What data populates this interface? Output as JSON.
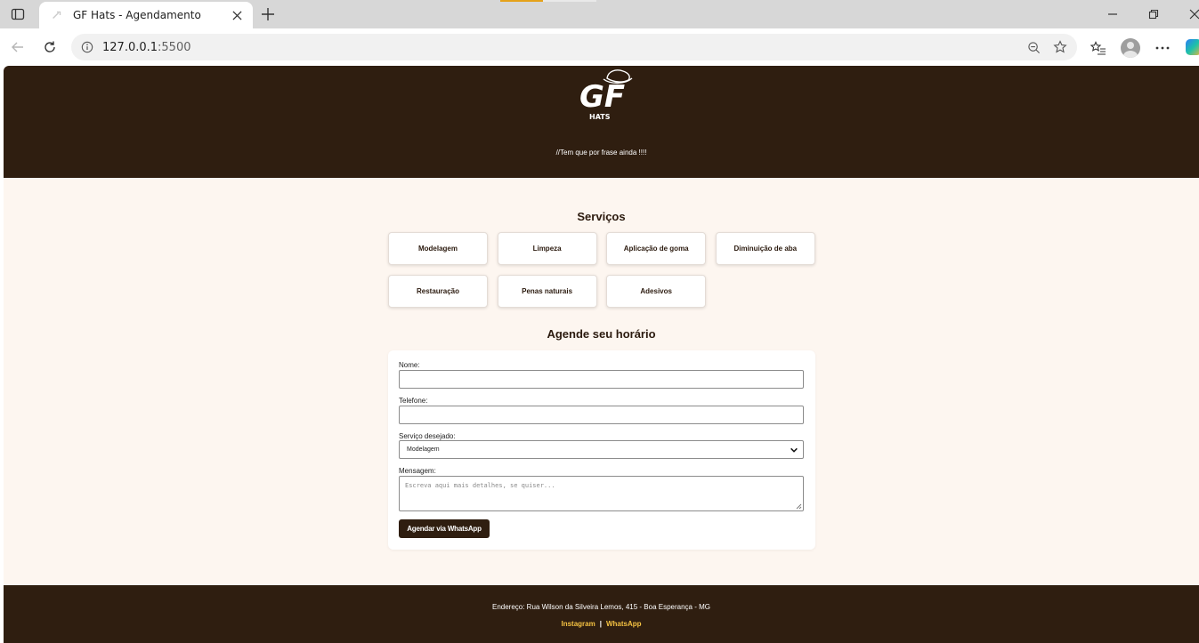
{
  "browser": {
    "tab_title": "GF Hats - Agendamento",
    "url_host": "127.0.0.1",
    "url_port": ":5500"
  },
  "header": {
    "logo_text": "GF",
    "logo_subtext": "HATS",
    "tagline": "//Tem que por frase ainda !!!!"
  },
  "services": {
    "title": "Serviços",
    "items": [
      "Modelagem",
      "Limpeza",
      "Aplicação de goma",
      "Diminuição de aba",
      "Restauração",
      "Penas naturais",
      "Adesivos"
    ]
  },
  "booking": {
    "title": "Agende seu horário",
    "name_label": "Nome:",
    "phone_label": "Telefone:",
    "service_label": "Serviço desejado:",
    "service_selected": "Modelagem",
    "message_label": "Mensagem:",
    "message_placeholder": "Escreva aqui mais detalhes, se quiser...",
    "submit_label": "Agendar via WhatsApp"
  },
  "footer": {
    "address": "Endereço: Rua Wilson da Silveira Lemos, 415 - Boa Esperança - MG",
    "instagram_label": "Instagram",
    "separator": "|",
    "whatsapp_label": "WhatsApp"
  },
  "colors": {
    "brand_dark": "#2f1e10",
    "page_bg": "#fdf6f0",
    "link_accent": "#f5c242"
  }
}
